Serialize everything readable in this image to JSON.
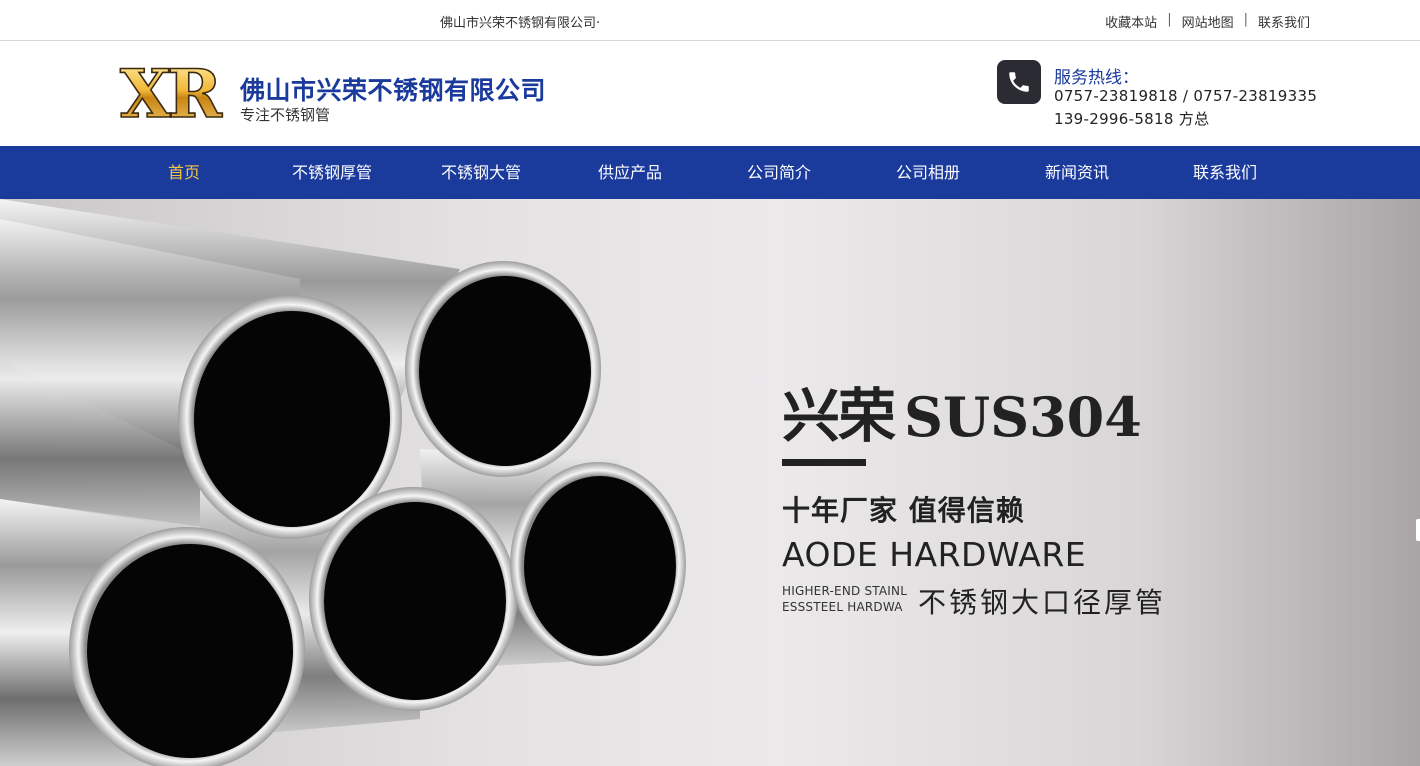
{
  "topbar": {
    "company": "佛山市兴荣不锈钢有限公司·",
    "links": [
      "收藏本站",
      "网站地图",
      "联系我们"
    ],
    "separator": "|"
  },
  "header": {
    "logo_text": "XR",
    "brand_name": "佛山市兴荣不锈钢有限公司",
    "slogan": "专注不锈钢管",
    "hotline_label": "服务热线：",
    "hotline_numbers": "0757-23819818 / 0757-23819335",
    "hotline_mobile": "139-2996-5818 方总",
    "icon": "phone-icon"
  },
  "nav": {
    "items": [
      {
        "label": "首页",
        "active": true
      },
      {
        "label": "不锈钢厚管",
        "active": false
      },
      {
        "label": "不锈钢大管",
        "active": false
      },
      {
        "label": "供应产品",
        "active": false
      },
      {
        "label": "公司简介",
        "active": false
      },
      {
        "label": "公司相册",
        "active": false
      },
      {
        "label": "新闻资讯",
        "active": false
      },
      {
        "label": "联系我们",
        "active": false
      }
    ]
  },
  "banner": {
    "title_cn": "兴荣",
    "title_en": "SUS304",
    "subtitle": "十年厂家 值得信赖",
    "english": "AODE HARDWARE",
    "small_line1": "HIGHER-END STAINL",
    "small_line2": "ESSSTEEL HARDWA",
    "cn_tagline": "不锈钢大口径厚管"
  },
  "colors": {
    "brand_blue": "#1a3a9c",
    "active_nav": "#f5c542",
    "logo_gold": "#e0a52a"
  }
}
